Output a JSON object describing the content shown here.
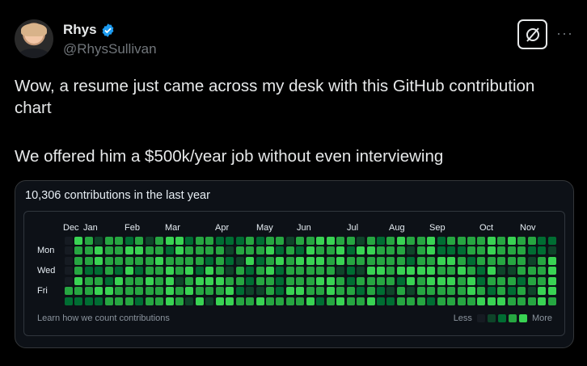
{
  "author": {
    "name": "Rhys",
    "handle": "@RhysSullivan"
  },
  "post": {
    "line1": "Wow, a resume just came across my desk with this GitHub contribution chart",
    "line2": "We offered him a $500k/year job without even interviewing"
  },
  "card": {
    "title": "10,306 contributions in the last year",
    "months": [
      "Dec",
      "Jan",
      "Feb",
      "Mar",
      "Apr",
      "May",
      "Jun",
      "Jul",
      "Aug",
      "Sep",
      "Oct",
      "Nov"
    ],
    "days": [
      "Mon",
      "Wed",
      "Fri"
    ],
    "footer_link": "Learn how we count contributions",
    "legend_less": "Less",
    "legend_more": "More",
    "level_colors": [
      "#161b22",
      "#0e4429",
      "#006d32",
      "#26a641",
      "#39d353"
    ]
  },
  "colors": {
    "accent_verified": "#1d9bf0",
    "background": "#000000",
    "card_background": "#0d1117"
  },
  "icons": [
    "verified-badge-icon",
    "grok-icon",
    "more-options-icon"
  ]
}
